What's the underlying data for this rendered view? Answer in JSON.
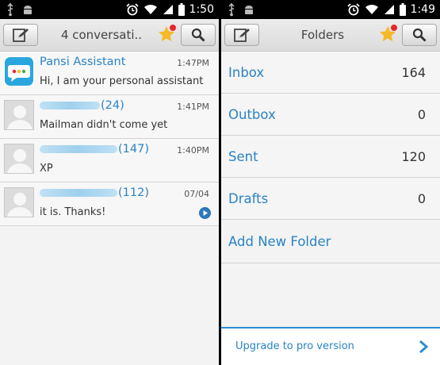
{
  "left_status": {
    "time": "1:50"
  },
  "right_status": {
    "time": "1:49"
  },
  "conversations_screen": {
    "title": "4 conversati..",
    "items": [
      {
        "name": "Pansi Assistant",
        "time": "1:47PM",
        "snippet": "Hi, I am your personal assistant"
      },
      {
        "count": "(24)",
        "time": "1:41PM",
        "snippet": "Mailman didn't come yet"
      },
      {
        "count": "(147)",
        "time": "1:40PM",
        "snippet": "XP"
      },
      {
        "count": "(112)",
        "time": "07/04",
        "snippet": "it is. Thanks!"
      }
    ]
  },
  "folders_screen": {
    "title": "Folders",
    "folders": [
      {
        "label": "Inbox",
        "count": "164"
      },
      {
        "label": "Outbox",
        "count": "0"
      },
      {
        "label": "Sent",
        "count": "120"
      },
      {
        "label": "Drafts",
        "count": "0"
      }
    ],
    "add_folder": "Add New Folder",
    "upgrade": "Upgrade to pro version"
  },
  "colors": {
    "accent": "#2a83c3",
    "star": "#f5b92a",
    "badge": "#e8262b"
  },
  "icons": [
    "usb-icon",
    "android-icon",
    "alarm-icon",
    "wifi-icon",
    "signal-icon",
    "battery-icon",
    "compose-icon",
    "star-icon",
    "search-icon",
    "play-icon",
    "chevron-right-icon"
  ]
}
